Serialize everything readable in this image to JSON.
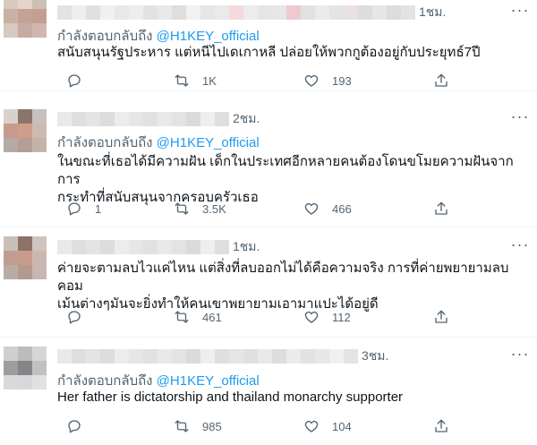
{
  "tweets": [
    {
      "time": "1ชม.",
      "reply_prefix": "กำลังตอบกลับถึง ",
      "handle": "@H1KEY_official",
      "text": "สนับสนุนรัฐประหาร แต่หนีไปเดเกาหลี ปล่อยให้พวกกูต้องอยู่กับประยุทธ์7ปี",
      "reply_count": "",
      "retweet_count": "1K",
      "like_count": "193",
      "avatar_colors": [
        "#d9c9bf",
        "#e4d4c9",
        "#cdbfb4",
        "#c9b1a5",
        "#c4a396",
        "#c59e92",
        "#d8c8c0",
        "#c7aaa2",
        "#d1b7b0"
      ],
      "name_blur_colors": [
        "#e3e3e3",
        "#eeeeee",
        "#e0e0e0",
        "#f0f0f0",
        "#e8e8e8",
        "#ededed",
        "#e2e2e2",
        "#e9e9e9",
        "#dedede",
        "#f1f1f1",
        "#e6e6e6",
        "#eaeaea",
        "#f4d9dd",
        "#ececec",
        "#e5e5e5",
        "#e7e7e7",
        "#efc9cf",
        "#e1e1e1",
        "#ebebeb",
        "#e4e4e4",
        "#e9e0e8",
        "#dddddd",
        "#e6e6e6",
        "#dcdcdc",
        "#e2e2e2"
      ]
    },
    {
      "time": "2ชม.",
      "reply_prefix": "กำลังตอบกลับถึง ",
      "handle": "@H1KEY_official",
      "text": "ในขณะที่เธอได้มีความฝัน เด็กในประเทศอีกหลายคนต้องโดนขโมยความฝันจากการ\nกระทำที่สนับสนุนจากครอบครัวเธอ",
      "reply_count": "1",
      "retweet_count": "3.5K",
      "like_count": "466",
      "avatar_colors": [
        "#d8d1cd",
        "#8b7469",
        "#c7c0bd",
        "#c59c8e",
        "#cf9d8b",
        "#cdbbb2",
        "#b7a9a4",
        "#b59e93",
        "#c5b3ab"
      ],
      "name_blur_colors": [
        "#e9e9e9",
        "#dedede",
        "#e4e4e4",
        "#dcdcdc",
        "#ececec",
        "#e6e6e6",
        "#e1e1e1",
        "#e9e9e9",
        "#e3e3e3",
        "#dbdbdb",
        "#eeeeee",
        "#dfdfdf"
      ]
    },
    {
      "time": "1ชม.",
      "reply_prefix": "",
      "handle": "",
      "text": "ค่ายจะตามลบไวแค่ไหน แต่สิ่งที่ลบออกไม่ได้คือความจริง การที่ค่ายพยายามลบคอม\nเม้นต่างๆมันจะยิ่งทำให้คนเขาพยายามเอามาแปะได้อยู่ดี",
      "reply_count": "",
      "retweet_count": "461",
      "like_count": "112",
      "avatar_colors": [
        "#c8bfba",
        "#8c7267",
        "#cfc4be",
        "#c19d90",
        "#c89c8c",
        "#cab8af",
        "#b9aba6",
        "#b29a8f",
        "#c7b7b0"
      ],
      "name_blur_colors": [
        "#e9e9e9",
        "#dedede",
        "#e4e4e4",
        "#dcdcdc",
        "#ececec",
        "#e6e6e6",
        "#e1e1e1",
        "#e9e9e9",
        "#e3e3e3",
        "#dbdbdb",
        "#eeeeee",
        "#dfdfdf"
      ]
    },
    {
      "time": "3ชม.",
      "reply_prefix": "กำลังตอบกลับถึง ",
      "handle": "@H1KEY_official",
      "text": "Her father is dictatorship and thailand monarchy supporter",
      "reply_count": "",
      "retweet_count": "985",
      "like_count": "104",
      "avatar_colors": [
        "#cfcfcf",
        "#bcbcbc",
        "#d6d6d6",
        "#9d9d9d",
        "#858585",
        "#c1c1c1",
        "#d9d9d9",
        "#d7d7dc",
        "#e1e1e1"
      ],
      "name_blur_colors": [
        "#e9e9e9",
        "#dedede",
        "#e4e4e4",
        "#dcdcdc",
        "#ececec",
        "#e6e6e6",
        "#e1e1e1",
        "#e9e9e9",
        "#e3e3e3",
        "#dbdbdb",
        "#eeeeee",
        "#dfdfdf",
        "#e5e5e5",
        "#e0e0e0",
        "#e8e8e8",
        "#dddddd",
        "#ebebeb",
        "#e2e2e2",
        "#e7e7e7",
        "#f0f0f0",
        "#e4e4e4"
      ]
    }
  ],
  "icons": {
    "reply": "reply-icon",
    "retweet": "retweet-icon",
    "like": "like-icon",
    "share": "share-icon",
    "more": "more-icon"
  },
  "colors": {
    "text": "#0f1419",
    "muted": "#536471",
    "link": "#1d9bf0",
    "divider": "#eff3f4"
  }
}
